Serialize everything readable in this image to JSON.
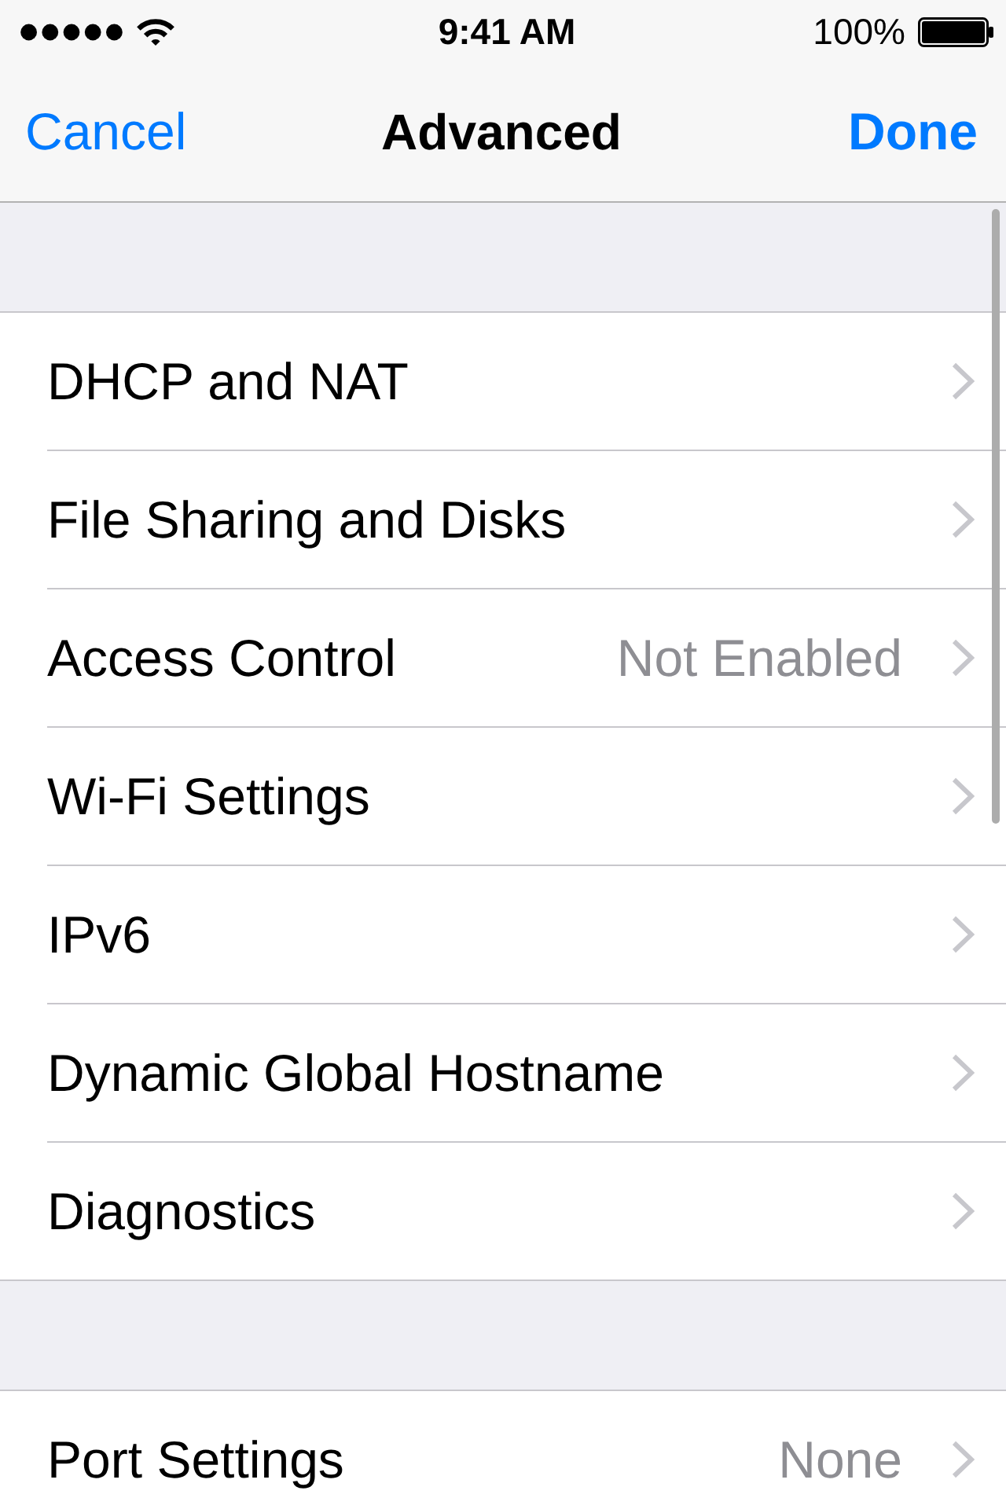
{
  "status_bar": {
    "time": "9:41 AM",
    "battery": "100%"
  },
  "nav_bar": {
    "left_button": "Cancel",
    "title": "Advanced",
    "right_button": "Done"
  },
  "sections": [
    {
      "rows": [
        {
          "label": "DHCP and NAT"
        },
        {
          "label": "File Sharing and Disks"
        },
        {
          "label": "Access Control",
          "value": "Not Enabled"
        },
        {
          "label": "Wi-Fi Settings"
        },
        {
          "label": "IPv6"
        },
        {
          "label": "Dynamic Global Hostname"
        },
        {
          "label": "Diagnostics"
        }
      ]
    },
    {
      "rows": [
        {
          "label": "Port Settings",
          "value": "None"
        }
      ]
    }
  ]
}
